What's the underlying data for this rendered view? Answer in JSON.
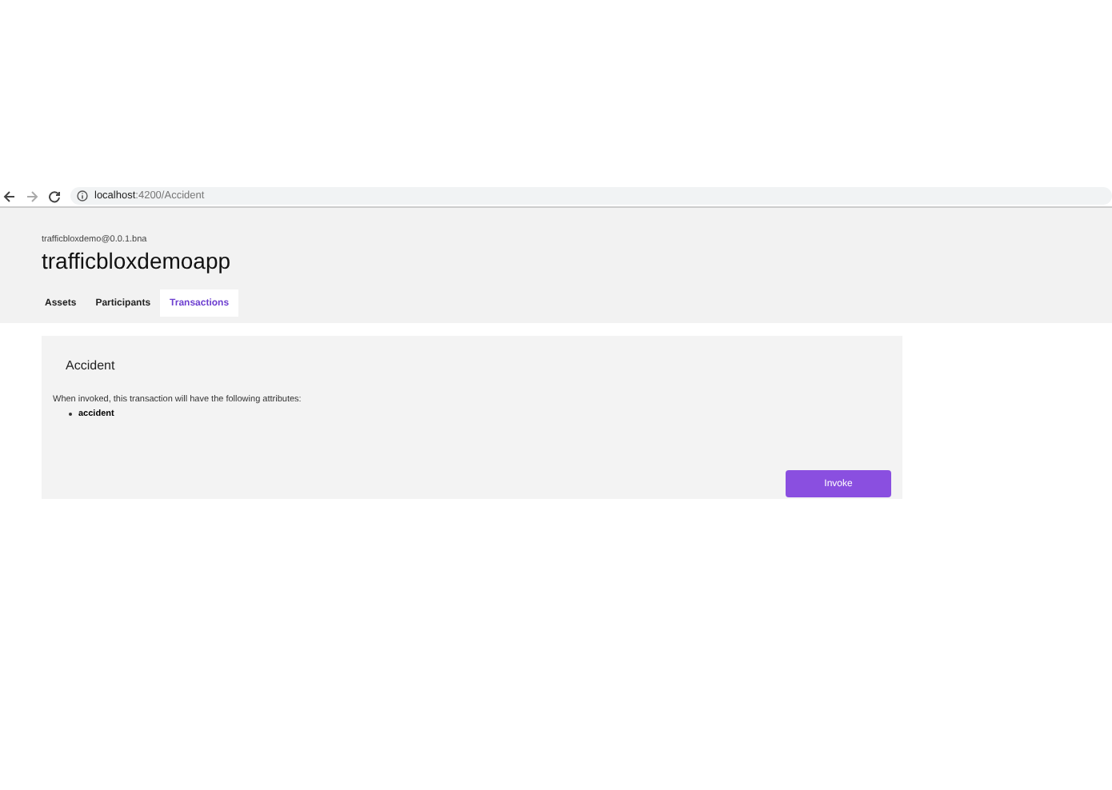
{
  "browser": {
    "url_host": "localhost",
    "url_path": ":4200/Accident"
  },
  "header": {
    "subtitle": "trafficbloxdemo@0.0.1.bna",
    "title": "trafficbloxdemoapp"
  },
  "tabs": [
    {
      "label": "Assets",
      "selected": false
    },
    {
      "label": "Participants",
      "selected": false
    },
    {
      "label": "Transactions",
      "selected": true
    }
  ],
  "card": {
    "title": "Accident",
    "description": "When invoked, this transaction will have the following attributes:",
    "attributes": [
      "accident"
    ],
    "button": "Invoke"
  }
}
